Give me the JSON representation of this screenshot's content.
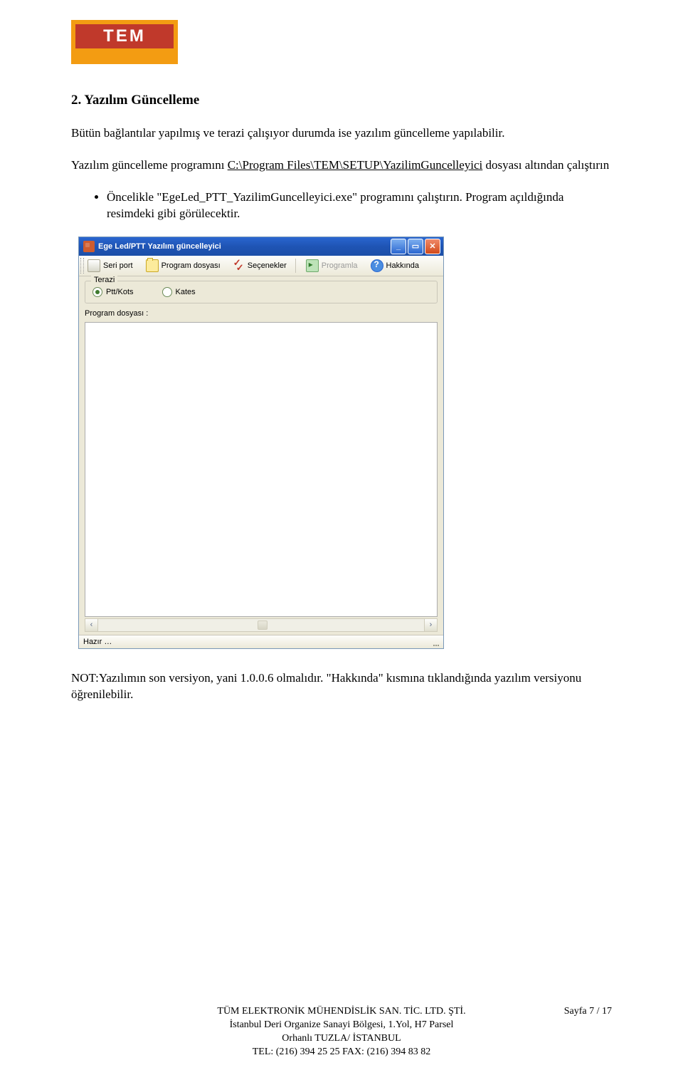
{
  "logo": {
    "text": "TEM"
  },
  "section": {
    "title": "2. Yazılım Güncelleme",
    "p1": "Bütün bağlantılar yapılmış ve terazi  çalışıyor durumda ise yazılım güncelleme yapılabilir.",
    "p2_a": "Yazılım güncelleme programını ",
    "p2_link": "C:\\Program Files\\TEM\\SETUP\\YazilimGuncelleyici",
    "p2_b": " dosyası altından çalıştırın",
    "bullet1": "Öncelikle \"EgeLed_PTT_YazilimGuncelleyici.exe\" programını çalıştırın. Program açıldığında resimdeki gibi görülecektir.",
    "note": "NOT:Yazılımın son versiyon, yani 1.0.0.6 olmalıdır. \"Hakkında\" kısmına tıklandığında yazılım versiyonu öğrenilebilir."
  },
  "app": {
    "title": "Ege Led/PTT Yazılım güncelleyici",
    "toolbar": {
      "serial": "Seri port",
      "program_file": "Program dosyası",
      "options": "Seçenekler",
      "program": "Programla",
      "about": "Hakkında"
    },
    "group_label": "Terazi",
    "radio1": "Ptt/Kots",
    "radio2": "Kates",
    "file_label": "Program dosyası :",
    "status": "Hazır …"
  },
  "footer": {
    "line1": "TÜM ELEKTRONİK MÜHENDİSLİK SAN. TİC. LTD. ŞTİ.",
    "line2": "İstanbul Deri Organize Sanayi Bölgesi, 1.Yol, H7 Parsel",
    "line3": "Orhanlı TUZLA/ İSTANBUL",
    "line4": "TEL: (216) 394 25 25 FAX: (216) 394 83 82",
    "page": "Sayfa 7 / 17"
  }
}
